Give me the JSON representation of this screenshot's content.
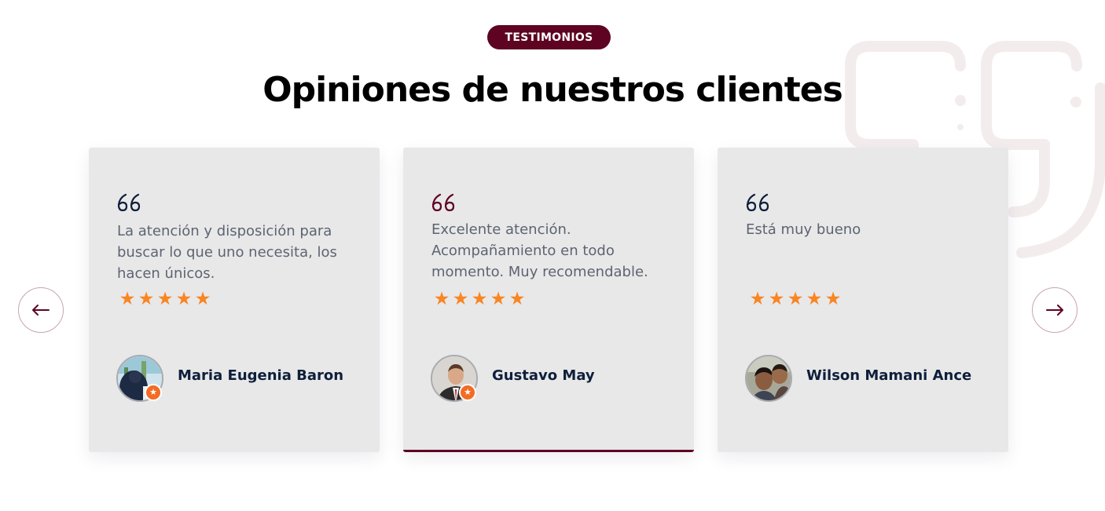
{
  "section": {
    "badge": "TESTIMONIOS",
    "title": "Opiniones de nuestros clientes"
  },
  "colors": {
    "brand": "#5e0321",
    "star": "#f98523",
    "card_bg": "#e8e8e9",
    "name": "#0e1f3a",
    "text": "#5d6470"
  },
  "testimonials": [
    {
      "text": "La atención y disposición para buscar lo que uno necesita, los hacen únicos.",
      "rating": 5,
      "name": "Maria Eugenia Baron",
      "quote_icon": "quote-open-icon",
      "active": false
    },
    {
      "text": "Excelente atención. Acompañamiento en todo momento. Muy recomendable.",
      "rating": 5,
      "name": "Gustavo May",
      "quote_icon": "quote-open-icon",
      "active": true
    },
    {
      "text": "Está muy bueno",
      "rating": 5,
      "name": "Wilson Mamani Ance",
      "quote_icon": "quote-open-icon",
      "active": false
    }
  ],
  "nav": {
    "prev_icon": "arrow-left-icon",
    "next_icon": "arrow-right-icon"
  }
}
